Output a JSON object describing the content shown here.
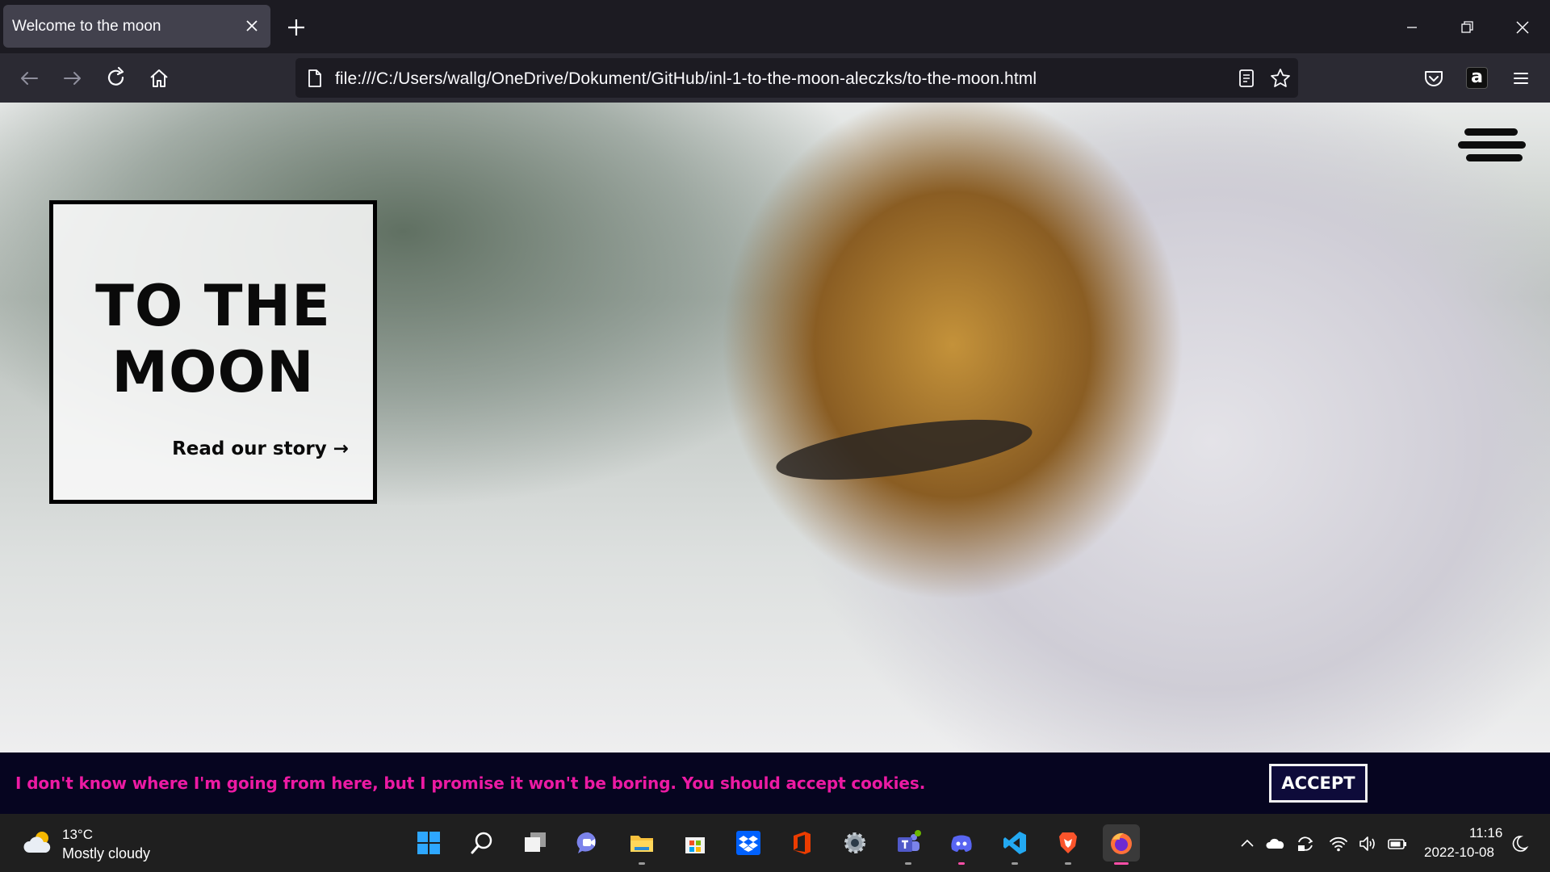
{
  "browser": {
    "tab_title": "Welcome to the moon",
    "url": "file:///C:/Users/wallg/OneDrive/Dokument/GitHub/inl-1-to-the-moon-aleczks/to-the-moon.html",
    "icons": [
      "close-icon",
      "plus-icon",
      "minimize-icon",
      "restore-icon",
      "window-close-icon",
      "back-arrow-icon",
      "forward-arrow-icon",
      "reload-icon",
      "home-icon",
      "page-icon",
      "reader-view-icon",
      "bookmark-star-icon",
      "pocket-icon",
      "amazon-icon",
      "hamburger-menu-icon"
    ],
    "amazon_letter": "a"
  },
  "page": {
    "title_line1": "TO THE",
    "title_line2": "MOON",
    "story_link": "Read our story →",
    "cookie_text": "I don't know where I'm going from here, but I promise it won't be boring. You should accept cookies.",
    "accept_label": "ACCEPT",
    "colors": {
      "cookie_bg": "#060520",
      "cookie_text": "#ec1aa3",
      "accept_bg": "#0e0b3a"
    }
  },
  "taskbar": {
    "weather_temp": "13°C",
    "weather_desc": "Mostly cloudy",
    "apps": [
      "windows-start",
      "search",
      "task-view",
      "chat",
      "file-explorer",
      "microsoft-store",
      "dropbox",
      "office",
      "settings",
      "teams",
      "discord",
      "vscode",
      "brave",
      "firefox"
    ],
    "active_app": "firefox",
    "clock_time": "11:16",
    "clock_date": "2022-10-08"
  }
}
